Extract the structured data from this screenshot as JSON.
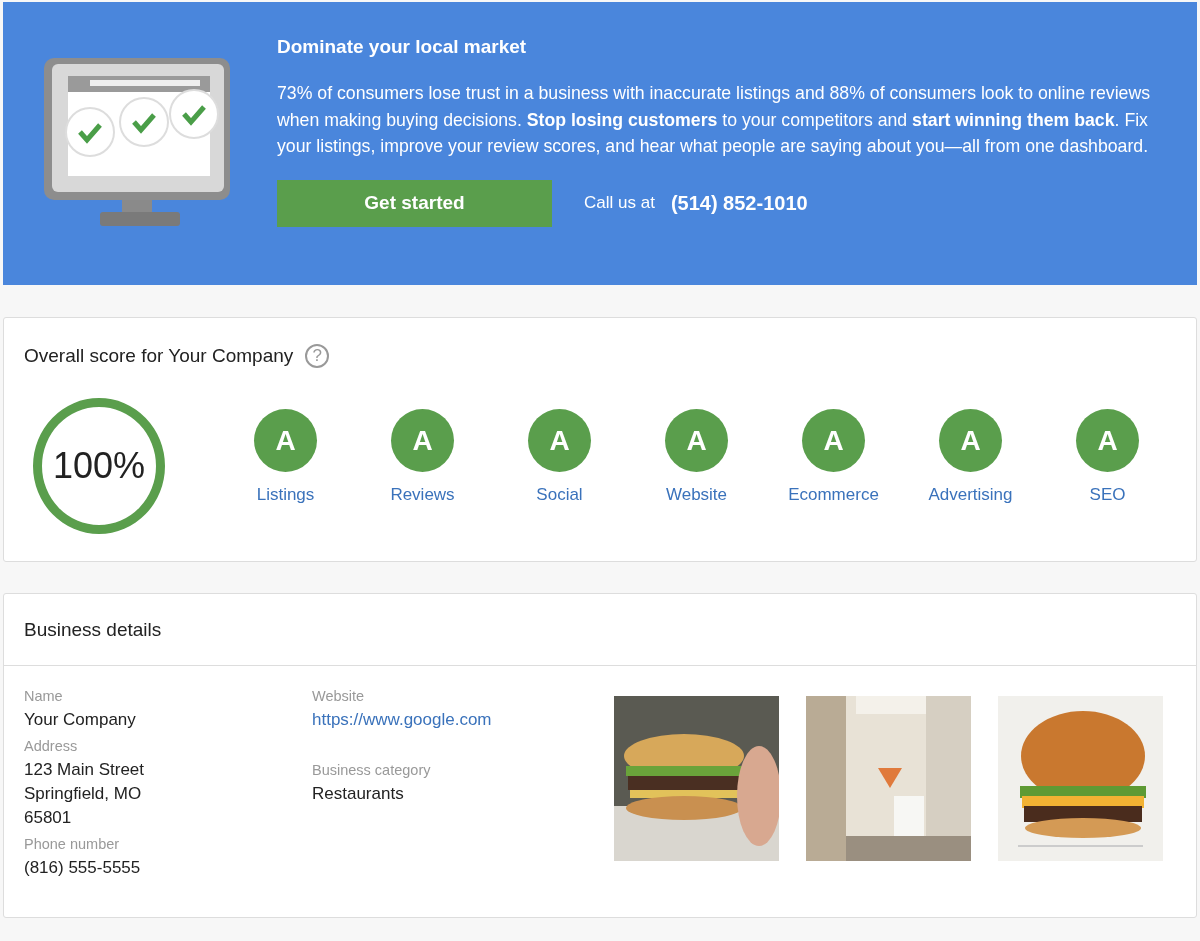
{
  "banner": {
    "title": "Dominate your local market",
    "text": "73% of consumers lose trust in a business with inaccurate listings and 88% of consumers look to online reviews when making buying decisions. **Stop losing customers** to your competitors and **start winning them back**. Fix your listings, improve your review scores, and hear what people are saying about you—all from one dashboard.",
    "button": "Get started",
    "call_label": "Call us at",
    "phone": "(514) 852-1010"
  },
  "score": {
    "title": "Overall score for Your Company",
    "help": "?",
    "percent": "100%",
    "grades": [
      {
        "grade": "A",
        "label": "Listings"
      },
      {
        "grade": "A",
        "label": "Reviews"
      },
      {
        "grade": "A",
        "label": "Social"
      },
      {
        "grade": "A",
        "label": "Website"
      },
      {
        "grade": "A",
        "label": "Ecommerce"
      },
      {
        "grade": "A",
        "label": "Advertising"
      },
      {
        "grade": "A",
        "label": "SEO"
      }
    ]
  },
  "business": {
    "title": "Business details",
    "name_label": "Name",
    "name": "Your Company",
    "address_label": "Address",
    "address": [
      "123 Main Street",
      "Springfield, MO",
      "65801"
    ],
    "phone_label": "Phone number",
    "phone": "(816) 555-5555",
    "website_label": "Website",
    "website": "https://www.google.com",
    "category_label": "Business category",
    "category": "Restaurants"
  }
}
